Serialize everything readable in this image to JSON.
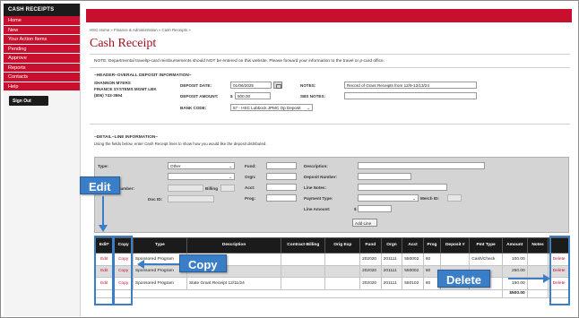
{
  "sidebar": {
    "heading": "CASH RECEIPTS",
    "items": [
      {
        "label": "Home"
      },
      {
        "label": "New"
      },
      {
        "label": "Your Action Items"
      },
      {
        "label": "Pending"
      },
      {
        "label": "Approve"
      },
      {
        "label": "Reports"
      },
      {
        "label": "Contacts"
      },
      {
        "label": "Help"
      }
    ],
    "signout": "Sign Out"
  },
  "breadcrumb": "HSC Home  »  Finance & Administration  »  Cash Receipts  »",
  "page_title": "Cash Receipt",
  "note": "NOTE: Departmental travel/p-card reimbursements should NOT be entered on this website. Please forward your information to the travel or p-card office.",
  "header": {
    "section_title": "~HEADER~OVERALL DEPOSIT INFORMATION~",
    "contact_name": "SHANNON MYERS",
    "contact_dept": "FINANCE SYSTEMS MGMT LBK",
    "contact_phone": "(806) 743-3694",
    "deposit_date_label": "DEPOSIT DATE:",
    "deposit_date": "01/06/2025",
    "deposit_amount_label": "DEPOSIT AMOUNT:",
    "currency": "$",
    "deposit_amount": "500.00",
    "bank_code_label": "BANK CODE:",
    "bank_code": "57 - HSC Lubbock JPMC Op Deposit",
    "notes_label": "NOTES:",
    "notes": "Record of Grant Receipts from 12/9-12/13/24",
    "sbs_notes_label": "SBS NOTES:",
    "sbs_notes": ""
  },
  "detail": {
    "section_title": "~DETAIL~LINE INFORMATION~",
    "instructions": "Using the fields below, enter Cash Receipt lines to show how you would like the deposit distributed.",
    "type_label": "Type:",
    "type_value": "Other",
    "number_label": "Number:",
    "billing_label": "Billing",
    "doc_id_label": "Doc ID:",
    "fund_label": "Fund:",
    "orgn_label": "Orgn:",
    "acct_label": "Acct:",
    "prog_label": "Prog:",
    "description_label": "Description:",
    "deposit_number_label": "Deposit Number:",
    "line_notes_label": "Line Notes:",
    "payment_type_label": "Payment Type:",
    "merch_id_label": "Merch ID:",
    "line_amount_label": "Line Amount:",
    "currency": "$",
    "add_line_label": "Add Line"
  },
  "table": {
    "headers": [
      "Edit*",
      "Copy",
      "Type",
      "Description",
      "Contract-Billing",
      "Orig Exp",
      "Fund",
      "Orgn",
      "Acct",
      "Prog",
      "Deposit #",
      "Pmt Type",
      "Amount",
      "Notes",
      ""
    ],
    "rows": [
      {
        "edit": "Edit",
        "copy": "Copy",
        "type": "Sponsored Program",
        "description": "State Grant Receipt",
        "contract": "",
        "orig": "",
        "fund": "202020",
        "orgn": "201111",
        "acct": "550002",
        "prog": "60",
        "deposit": "",
        "pmt_type": "Cash/Check",
        "amount": "100.00",
        "notes": "",
        "delete": "Delete"
      },
      {
        "edit": "Edit",
        "copy": "Copy",
        "type": "Sponsored Program",
        "description": "12/13/24",
        "contract": "",
        "orig": "",
        "fund": "202020",
        "orgn": "201111",
        "acct": "550002",
        "prog": "60",
        "deposit": "",
        "pmt_type": "",
        "amount": "250.00",
        "notes": "",
        "delete": "Delete"
      },
      {
        "edit": "Edit",
        "copy": "Copy",
        "type": "Sponsored Program",
        "description": "State Grant Receipt 12/11/24",
        "contract": "",
        "orig": "",
        "fund": "202020",
        "orgn": "201111",
        "acct": "550102",
        "prog": "60",
        "deposit": "",
        "pmt_type": "",
        "amount": "150.00",
        "notes": "",
        "delete": "Delete"
      }
    ],
    "total": "$500.00"
  },
  "callouts": {
    "edit": "Edit",
    "copy": "Copy",
    "delete": "Delete"
  },
  "colors": {
    "brand_red": "#c8102e",
    "callout_blue": "#3a7ec8",
    "header_black": "#1b1b1b"
  }
}
